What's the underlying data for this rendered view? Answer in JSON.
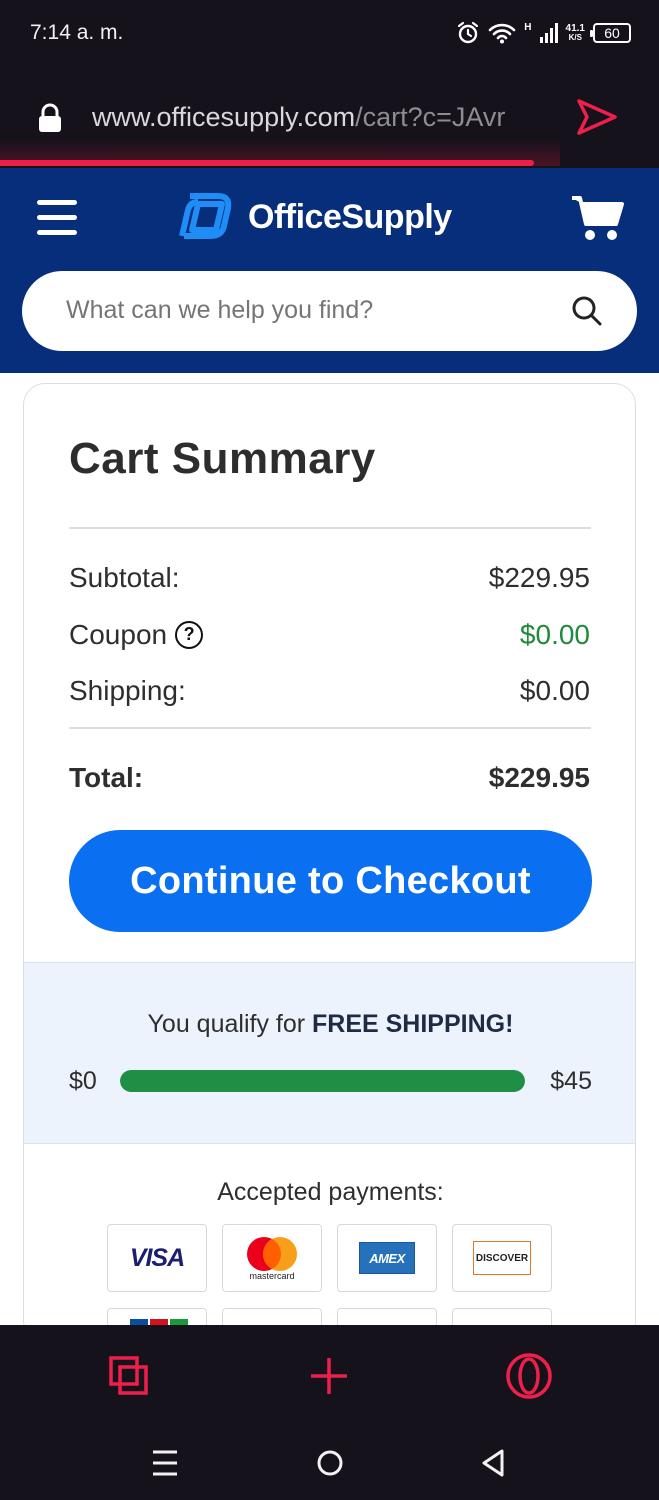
{
  "status_bar": {
    "time": "7:14 a. m.",
    "network_type": "H",
    "speed_value": "41.1",
    "speed_unit": "K/S",
    "battery": "60"
  },
  "browser": {
    "url_domain": "www.officesupply.com",
    "url_path": "/cart?c=JAvr",
    "load_progress": 0.81
  },
  "header": {
    "logo_text": "OfficeSupply",
    "search_placeholder": "What can we help you find?"
  },
  "cart_summary": {
    "title": "Cart Summary",
    "rows": [
      {
        "label": "Subtotal:",
        "value": "$229.95"
      },
      {
        "label": "Coupon",
        "value": "$0.00"
      },
      {
        "label": "Shipping:",
        "value": "$0.00"
      }
    ],
    "total_label": "Total:",
    "total_value": "$229.95",
    "checkout_label": "Continue to Checkout"
  },
  "free_shipping": {
    "message_prefix": "You qualify for ",
    "message_bold": "FREE SHIPPING!",
    "min_label": "$0",
    "max_label": "$45",
    "progress": 1.0
  },
  "payments": {
    "title": "Accepted payments:",
    "methods": [
      "VISA",
      "mastercard",
      "AMEX",
      "DISCOVER"
    ]
  },
  "colors": {
    "header_bg": "#062e7b",
    "primary_button": "#0a6ff0",
    "success_green": "#1f8f45",
    "browser_accent": "#ef1f4b"
  }
}
